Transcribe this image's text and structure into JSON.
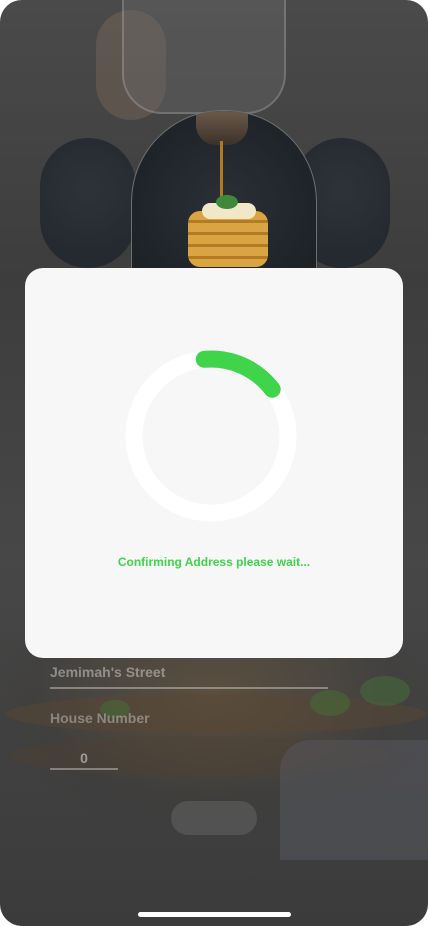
{
  "form": {
    "street_value": "Jemimah's Street",
    "house_number_label": "House Number",
    "house_number_value": "0"
  },
  "loading_modal": {
    "status_text": "Confirming Address please wait...",
    "progress": 0.16,
    "accent_color": "#3fd44a"
  }
}
